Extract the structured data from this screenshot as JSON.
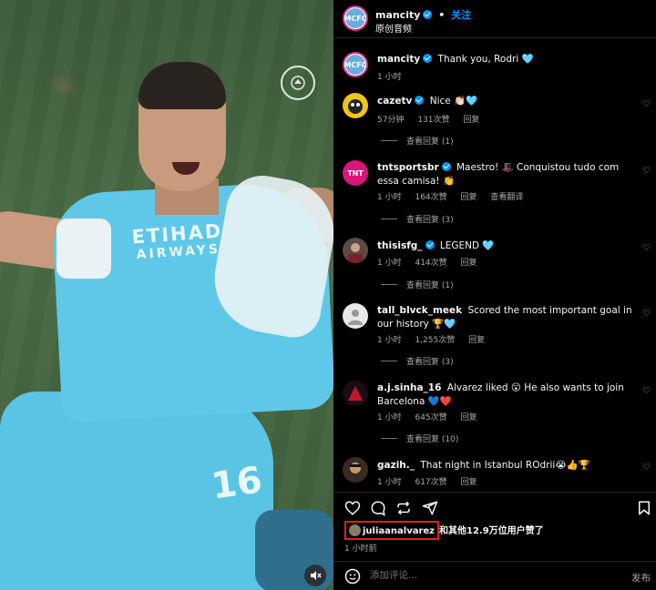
{
  "header": {
    "username": "mancity",
    "dot": "•",
    "follow_label": "关注",
    "audio": "原创音频"
  },
  "caption": {
    "username": "mancity",
    "text": "Thank you, Rodri 🩵",
    "time": "1 小时"
  },
  "comments": [
    {
      "username": "cazetv",
      "text": "Nice 👏🏻🩵",
      "time": "57分钟",
      "likes": "131次赞",
      "reply": "回复",
      "view_replies": "查看回复 (1)"
    },
    {
      "username": "tntsportsbr",
      "text": "Maestro! 🎩 Conquistou tudo com essa camisa! 👏",
      "time": "1 小时",
      "likes": "164次赞",
      "reply": "回复",
      "translate": "查看翻译",
      "view_replies": "查看回复 (3)"
    },
    {
      "username": "thisisfg_",
      "text": "LEGEND 🩵",
      "time": "1 小时",
      "likes": "414次赞",
      "reply": "回复",
      "view_replies": "查看回复 (1)"
    },
    {
      "username": "tall_blvck_meek",
      "text": "Scored the most important goal in our history 🏆🩵",
      "time": "1 小时",
      "likes": "1,255次赞",
      "reply": "回复",
      "view_replies": "查看回复 (3)"
    },
    {
      "username": "a.j.sinha_16",
      "text": "Alvarez liked 😮 He also wants to join Barcelona 💙❤️",
      "time": "1 小时",
      "likes": "645次赞",
      "reply": "回复",
      "view_replies": "查看回复 (10)"
    },
    {
      "username": "gazih._",
      "text": "That night in Istanbul ROdrii😭👍🏆",
      "time": "1 小时",
      "likes": "617次赞",
      "reply": "回复"
    }
  ],
  "likes_line": {
    "liker": "juliaanalvarez",
    "rest": "和其他12.9万位用户赞了"
  },
  "posted": "1 小时前",
  "add_comment": {
    "placeholder": "添加评论...",
    "post_label": "发布"
  },
  "video": {
    "sponsor_line1": "ETIHAD",
    "sponsor_line2": "AIRWAYS",
    "shirt_number": "16"
  },
  "colors": {
    "accent": "#0095f6",
    "highlight_box": "#e02020",
    "shirt": "#5fc8e8"
  }
}
